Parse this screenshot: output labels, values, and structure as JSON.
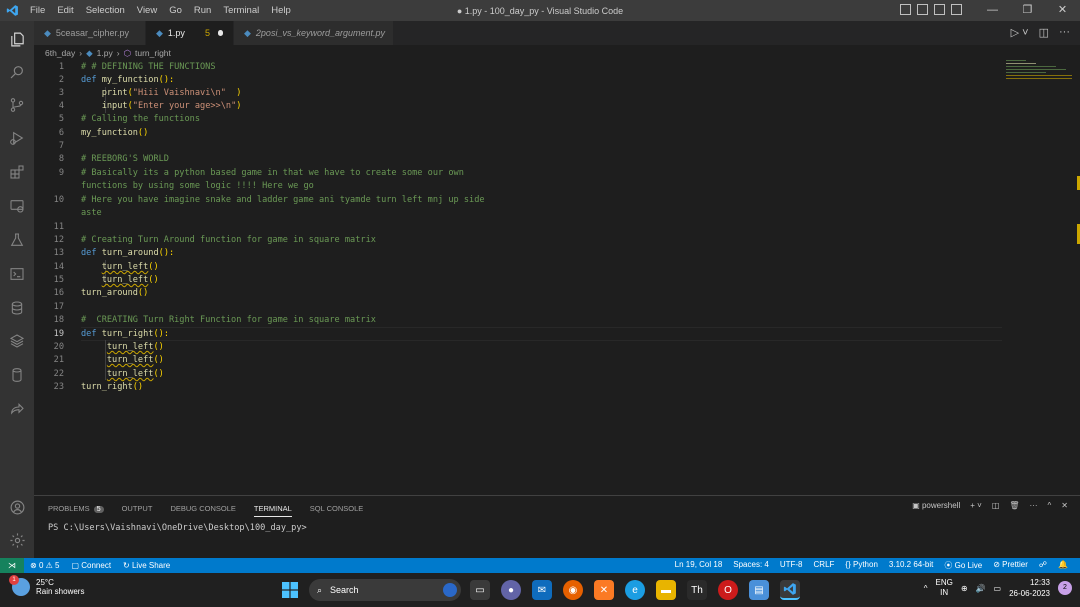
{
  "titlebar": {
    "menu": [
      "File",
      "Edit",
      "Selection",
      "View",
      "Go",
      "Run",
      "Terminal",
      "Help"
    ],
    "window_title": "● 1.py - 100_day_py - Visual Studio Code"
  },
  "tabs": [
    {
      "label": "5ceasar_cipher.py"
    },
    {
      "label": "1.py",
      "badge": "5"
    },
    {
      "label": "2posi_vs_keyword_argument.py"
    }
  ],
  "breadcrumb": {
    "folder": "6th_day",
    "file": "1.py",
    "symbol": "turn_right"
  },
  "editor": {
    "line_numbers": [
      "1",
      "2",
      "3",
      "4",
      "5",
      "6",
      "7",
      "8",
      "9",
      "",
      "10",
      "",
      "11",
      "12",
      "13",
      "14",
      "15",
      "16",
      "17",
      "18",
      "19",
      "20",
      "21",
      "22",
      "23"
    ],
    "lines": {
      "l1": "# # DEFINING THE FUNCTIONS",
      "l2_kw": "def",
      "l2_fn": "my_function",
      "l2_p": "():",
      "l3_fn": "print",
      "l3_str": "\"Hiii Vaishnavi\\n\"",
      "l4_fn": "input",
      "l4_str": "\"Enter your age>>\\n\"",
      "l5": "# Calling the functions",
      "l6_fn": "my_function",
      "l6_p": "()",
      "l8": "# REEBORG'S WORLD",
      "l9a": "# Basically its a python based game in that we have to create some our own",
      "l9b": "functions by using some logic !!!! Here we go",
      "l10a": "# Here you have imagine snake and ladder game ani tyamde turn left mnj up side",
      "l10b": "aste",
      "l12": "# Creating Turn Around function for game in square matrix",
      "l13_kw": "def",
      "l13_fn": "turn_around",
      "l13_p": "():",
      "turn_left": "turn_left",
      "call": "()",
      "l16_fn": "turn_around",
      "l18": "#  CREATING Turn Right Function for game in square matrix",
      "l19_kw": "def",
      "l19_fn": "turn_right",
      "l19_p": "():",
      "l23_fn": "turn_right"
    }
  },
  "panel": {
    "tabs": [
      "PROBLEMS",
      "OUTPUT",
      "DEBUG CONSOLE",
      "TERMINAL",
      "SQL CONSOLE"
    ],
    "problems_count": "5",
    "shell": "powershell",
    "prompt": "PS C:\\Users\\Vaishnavi\\OneDrive\\Desktop\\100_day_py>"
  },
  "statusbar": {
    "errors": "0",
    "warnings": "5",
    "connect": "Connect",
    "liveshare": "Live Share",
    "position": "Ln 19, Col 18",
    "spaces": "Spaces: 4",
    "encoding": "UTF-8",
    "eol": "CRLF",
    "language": "Python",
    "interpreter": "3.10.2 64-bit",
    "golive": "Go Live",
    "prettier": "Prettier"
  },
  "taskbar": {
    "weather_temp": "25°C",
    "weather_desc": "Rain showers",
    "weather_badge": "1",
    "search": "Search",
    "lang1": "ENG",
    "lang2": "IN",
    "time": "12:33",
    "date": "26-06-2023",
    "notifications": "2"
  }
}
